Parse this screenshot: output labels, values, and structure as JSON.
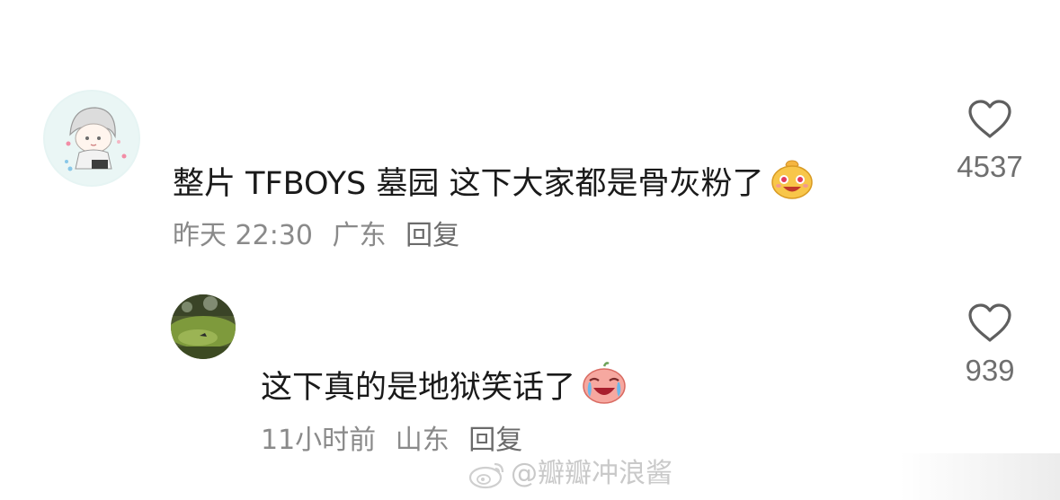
{
  "comments": [
    {
      "text": "整片 TFBOYS 墓园 这下大家都是骨灰粉了",
      "emoji": "grinning-face-emoji",
      "time": "昨天 22:30",
      "location": "广东",
      "reply_label": "回复",
      "like_count": "4537",
      "avatar": "anime-boy-avatar"
    },
    {
      "text": "这下真的是地狱笑话了",
      "emoji": "crying-laughing-face-emoji",
      "time": "11小时前",
      "location": "山东",
      "reply_label": "回复",
      "like_count": "939",
      "avatar": "green-landscape-avatar"
    }
  ],
  "watermark": {
    "text": "@瓣瓣冲浪酱",
    "icon": "weibo-logo-icon"
  },
  "colors": {
    "text": "#1a1a1a",
    "meta": "#8a8a8a",
    "count": "#6f6f6f",
    "heart": "#5f5f5f"
  }
}
